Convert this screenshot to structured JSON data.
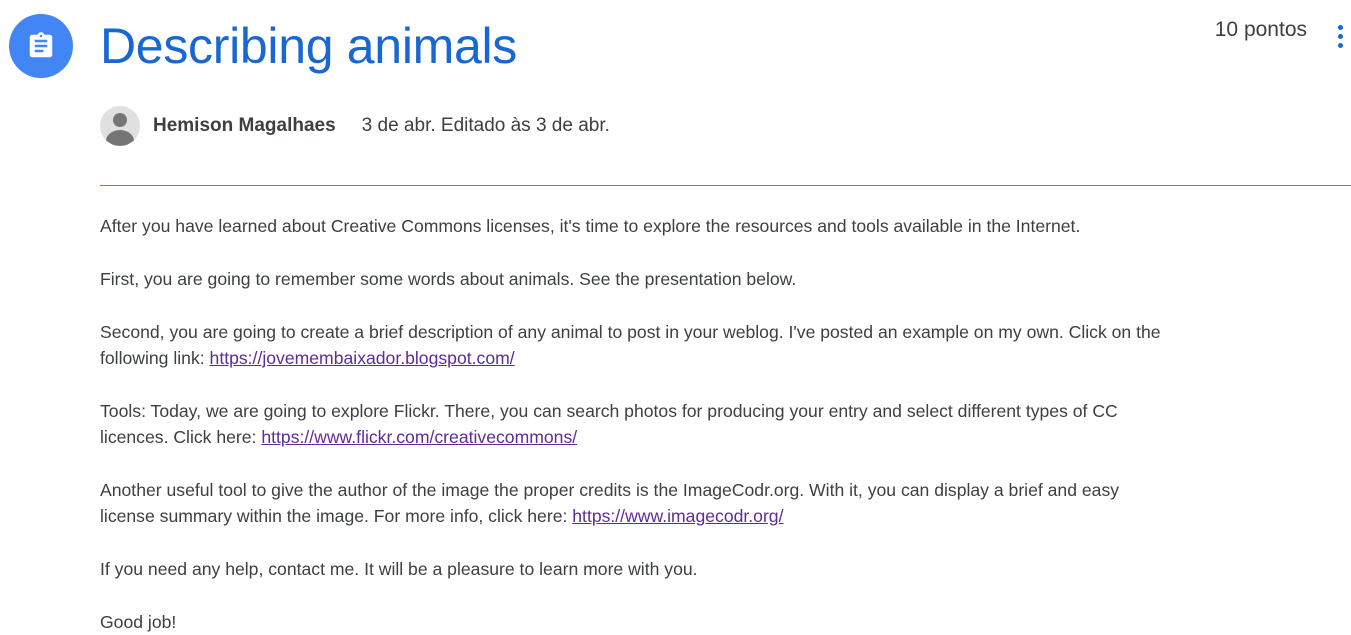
{
  "assignment": {
    "icon": "assignment-icon",
    "title": "Describing animals",
    "points": "10 pontos",
    "menu_icon": "more-vert-icon"
  },
  "author": {
    "avatar_icon": "person-icon",
    "name": "Hemison Magalhaes",
    "date": "3 de abr. Editado às 3 de abr."
  },
  "body": {
    "p1": "After you have learned about Creative Commons licenses, it's time to explore the resources and tools available in the Internet.",
    "p2": "First, you are going to remember some words about animals. See the presentation below.",
    "p3_line1": "Second, you are going to create a brief description of any animal to post in your weblog. I've posted an example on my own. Click on the",
    "p3_line2": "following link: ",
    "p3_link": "https://jovemembaixador.blogspot.com/",
    "p4_line1": "Tools: Today, we are going to explore Flickr. There, you can search photos for producing your entry and select different types of CC",
    "p4_line2": "licences. Click here: ",
    "p4_link": "https://www.flickr.com/creativecommons/",
    "p5_line1": "Another useful tool to give the author of the image the proper credits is the ImageCodr.org. With it, you can display a brief and easy",
    "p5_line2": "license summary within the image. For more info, click here: ",
    "p5_link": "https://www.imagecodr.org/",
    "p6": "If you need any help, contact me. It will be a pleasure to learn more with you.",
    "p7": "Good job!"
  },
  "colors": {
    "accent": "#4285f4",
    "title": "#1967d2",
    "link": "#5f2b96",
    "text": "#3c4043"
  }
}
